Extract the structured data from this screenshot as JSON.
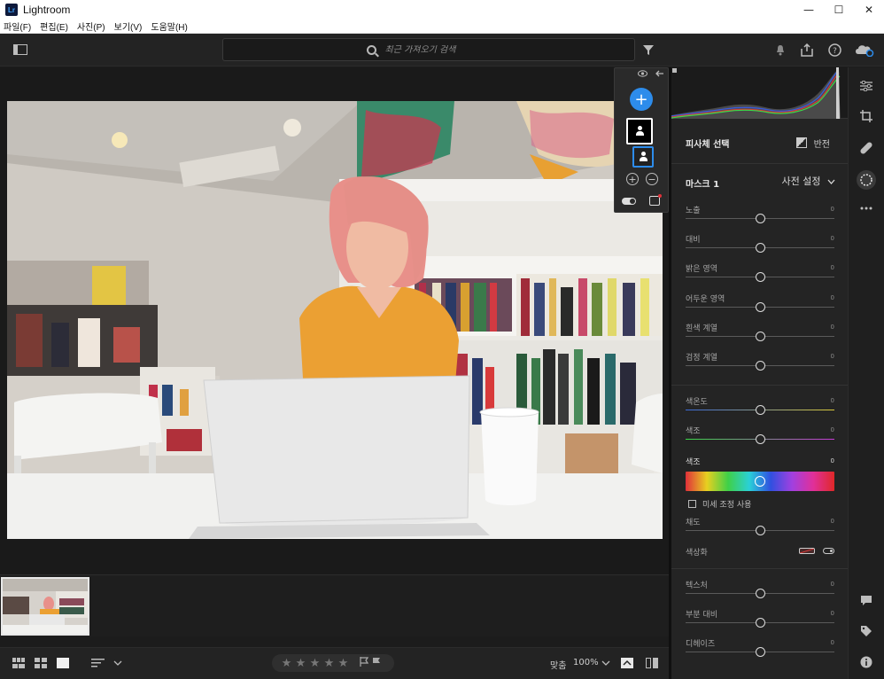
{
  "window": {
    "app_logo": "Lr",
    "title": "Lightroom",
    "minimize": "—",
    "maximize": "☐",
    "close": "✕"
  },
  "menu": [
    "파일(F)",
    "편집(E)",
    "사진(P)",
    "보기(V)",
    "도움말(H)"
  ],
  "toolbar": {
    "search_placeholder": "최근 가져오기 검색"
  },
  "mask_panel": {
    "add_label": "+"
  },
  "right_panel": {
    "subject_section_title": "피사체 선택",
    "invert_label": "반전",
    "mask_name": "마스크 1",
    "preset_label": "사전 설정",
    "sliders": [
      {
        "label": "노출",
        "value": "0",
        "position": 0.5
      },
      {
        "label": "대비",
        "value": "0",
        "position": 0.5
      },
      {
        "label": "밝은 영역",
        "value": "0",
        "position": 0.5
      },
      {
        "label": "어두운 영역",
        "value": "0",
        "position": 0.5
      },
      {
        "label": "흰색 계열",
        "value": "0",
        "position": 0.5
      },
      {
        "label": "검정 계열",
        "value": "0",
        "position": 0.5
      },
      {
        "label": "색온도",
        "value": "0",
        "position": 0.5
      },
      {
        "label": "색조",
        "value": "0",
        "position": 0.5
      }
    ],
    "hue": {
      "label": "색조",
      "value": "0",
      "position": 0.5
    },
    "fine_adjust_label": "미세 조정 사용",
    "saturation": {
      "label": "채도",
      "value": "0",
      "position": 0.5
    },
    "color_grading_label": "색상화",
    "detail_sliders": [
      {
        "label": "텍스처",
        "value": "0",
        "position": 0.5
      },
      {
        "label": "부분 대비",
        "value": "0",
        "position": 0.5
      },
      {
        "label": "디헤이즈",
        "value": "0",
        "position": 0.5
      }
    ]
  },
  "bottombar": {
    "rating_stars": [
      "★",
      "★",
      "★",
      "★",
      "★"
    ],
    "fit_label": "맞춤",
    "zoom_label": "100%"
  },
  "colors": {
    "accent": "#2d8ceb",
    "panel_bg": "#242424",
    "canvas_bg": "#1a1a1a"
  }
}
